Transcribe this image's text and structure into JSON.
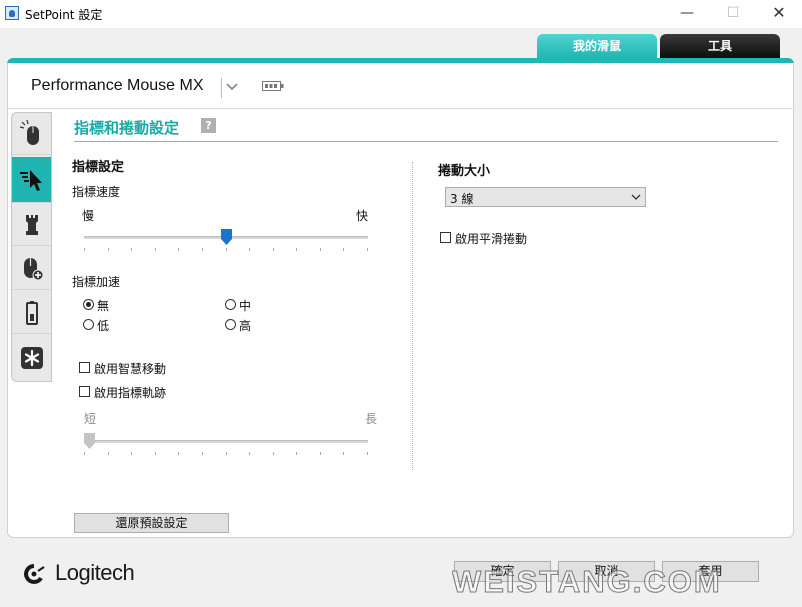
{
  "window": {
    "title": "SetPoint 設定",
    "controls": {
      "minimize": "—",
      "maximize": "☐",
      "close": "✕"
    }
  },
  "tabs": [
    {
      "label": "我的滑鼠",
      "active": true
    },
    {
      "label": "工具",
      "active": false
    }
  ],
  "device": {
    "name": "Performance Mouse MX",
    "icon": "battery-icon"
  },
  "side_nav": [
    {
      "name": "mouse-buttons",
      "icon": "mouse-click-icon"
    },
    {
      "name": "pointer-scroll",
      "icon": "pointer-icon",
      "active": true
    },
    {
      "name": "game",
      "icon": "chess-rook-icon"
    },
    {
      "name": "device-settings",
      "icon": "mouse-plus-icon"
    },
    {
      "name": "battery",
      "icon": "battery-status-icon"
    },
    {
      "name": "advanced",
      "icon": "asterisk-icon"
    }
  ],
  "section": {
    "title": "指標和捲動設定",
    "help": "?"
  },
  "pointer": {
    "heading": "指標設定",
    "speed": {
      "label": "指標速度",
      "min_label": "慢",
      "max_label": "快",
      "value_fraction": 0.5
    },
    "acceleration": {
      "label": "指標加速",
      "options": [
        {
          "label": "無",
          "selected": true
        },
        {
          "label": "中",
          "selected": false
        },
        {
          "label": "低",
          "selected": false
        },
        {
          "label": "高",
          "selected": false
        }
      ]
    },
    "smart_move": {
      "label": "啟用智慧移動",
      "checked": false
    },
    "trails": {
      "label": "啟用指標軌跡",
      "checked": false,
      "min_label": "短",
      "max_label": "長",
      "value_fraction": 0.0
    }
  },
  "scroll": {
    "heading": "捲動大小",
    "select_value": "3 線",
    "smooth": {
      "label": "啟用平滑捲動",
      "checked": false
    }
  },
  "buttons": {
    "reset": "還原預設設定",
    "ok": "確定",
    "cancel": "取消",
    "apply": "套用"
  },
  "logo": {
    "text": "Logitech"
  },
  "colors": {
    "accent": "#1fb4b0",
    "tab_dark": "#111111",
    "slider_thumb": "#1b75d0"
  }
}
